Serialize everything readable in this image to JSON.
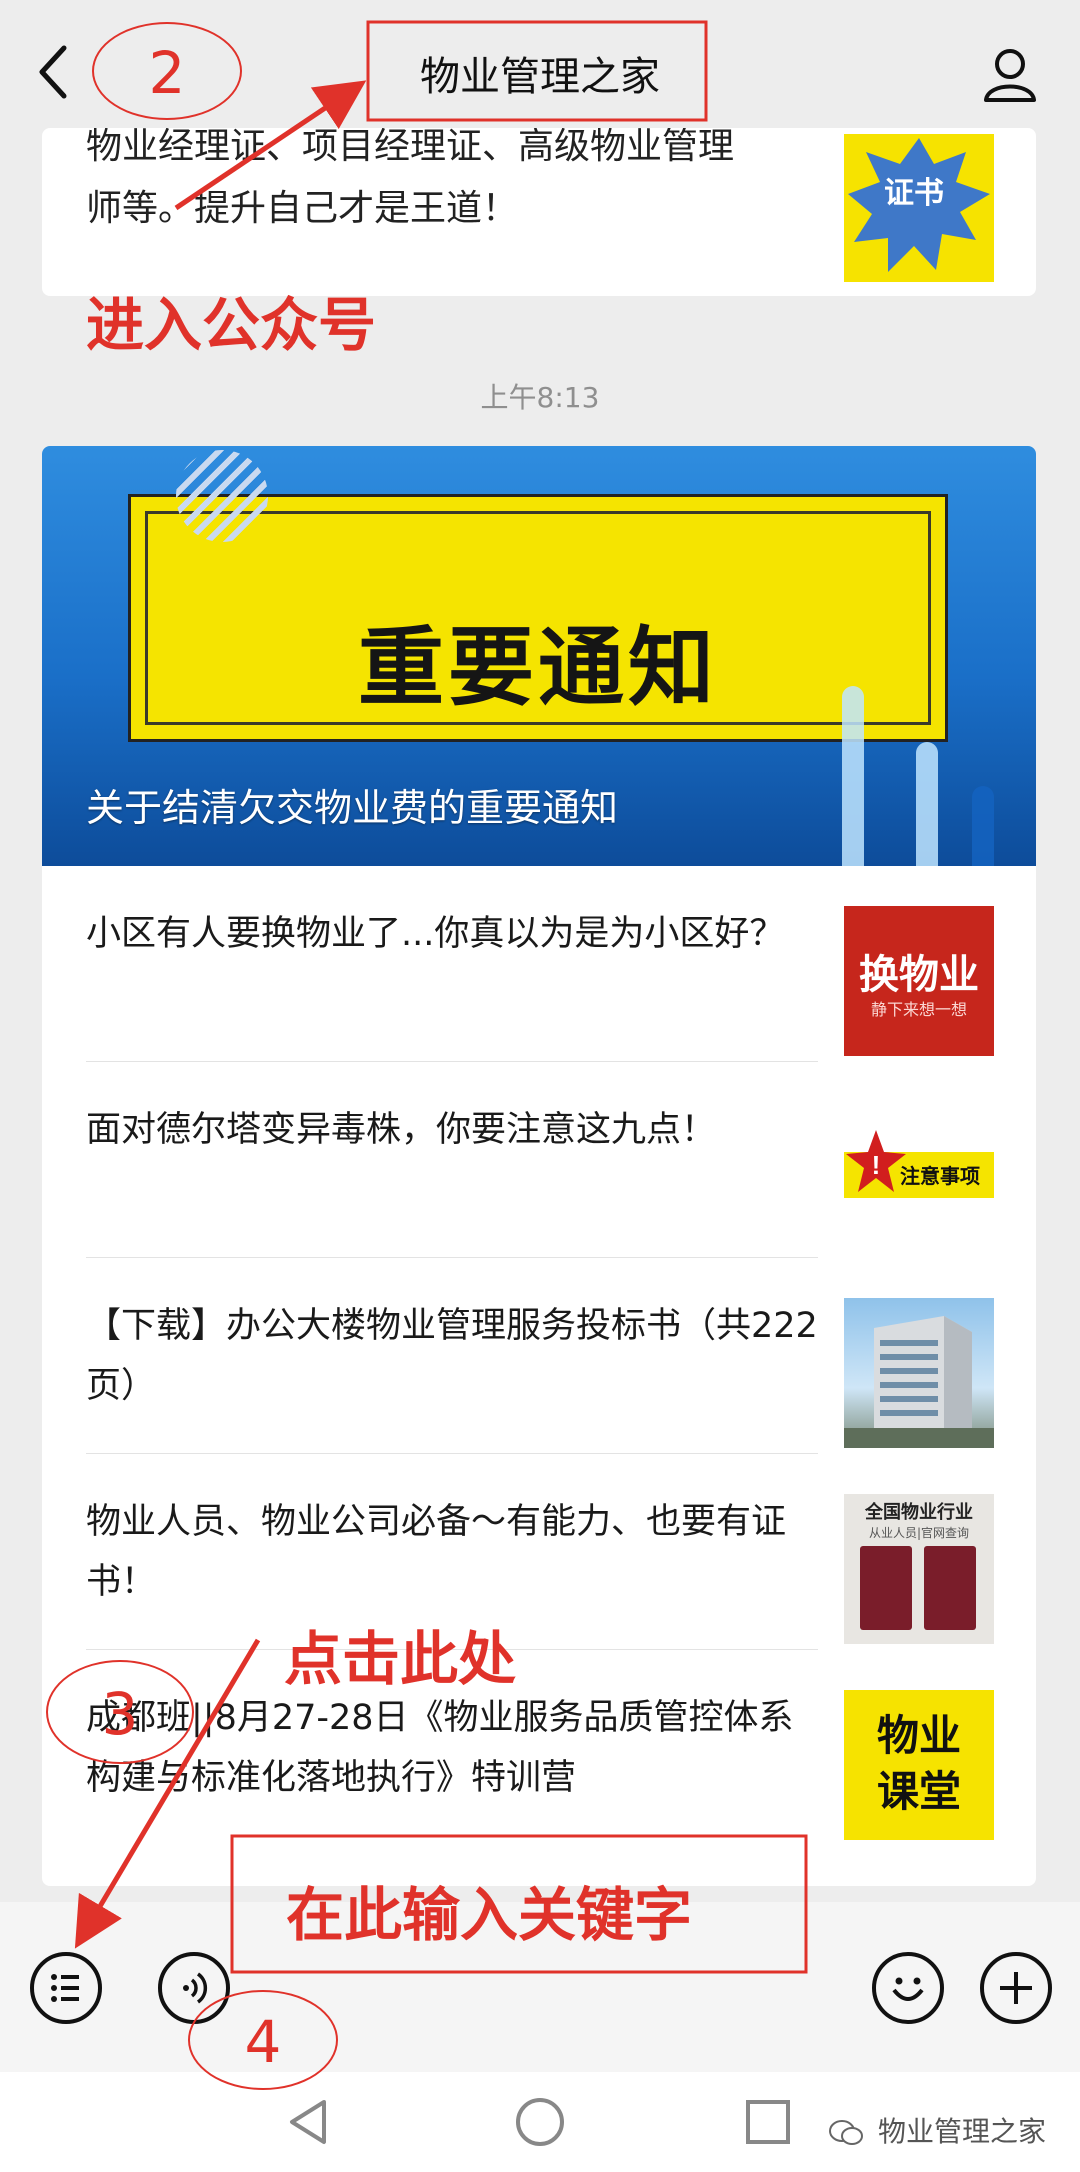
{
  "header": {
    "title": "物业管理之家"
  },
  "previous_card": {
    "text_line1": "物业经理证、项目经理证、高级物业管理",
    "text_line2": "师等。提升自己才是王道！",
    "thumb_label": "证书"
  },
  "timestamp": "上午8:13",
  "banner": {
    "heading": "重要通知",
    "caption": "关于结清欠交物业费的重要通知"
  },
  "articles": [
    {
      "text": "小区有人要换物业了...你真以为是为小区好？",
      "thumb_title": "换物业",
      "thumb_sub": "静下来想一想"
    },
    {
      "text": "面对德尔塔变异毒株，你要注意这九点！",
      "thumb_title": "注意事项"
    },
    {
      "text": "【下载】办公大楼物业管理服务投标书（共222页）"
    },
    {
      "text": "物业人员、物业公司必备～有能力、也要有证书！",
      "thumb_title": "全国物业行业",
      "thumb_sub": "从业人员|官网查询"
    },
    {
      "text": "成都班||8月27-28日《物业服务品质管控体系构建与标准化落地执行》特训营",
      "thumb_title": "物业课堂"
    }
  ],
  "annotations": {
    "step2": "2",
    "enter_account": "进入公众号",
    "step3": "3",
    "click_here": "点击此处",
    "step4": "4",
    "input_keyword": "在此输入关键字"
  },
  "watermark": "物业管理之家",
  "colors": {
    "annotation_red": "#e0322a",
    "banner_yellow": "#f5e400",
    "banner_blue": "#1a6fc8",
    "background": "#ededed"
  },
  "icons": [
    "back-icon",
    "profile-icon",
    "menu-list-icon",
    "voice-icon",
    "emoji-icon",
    "add-icon",
    "nav-back-icon",
    "nav-home-icon",
    "nav-recent-icon",
    "wechat-icon"
  ]
}
